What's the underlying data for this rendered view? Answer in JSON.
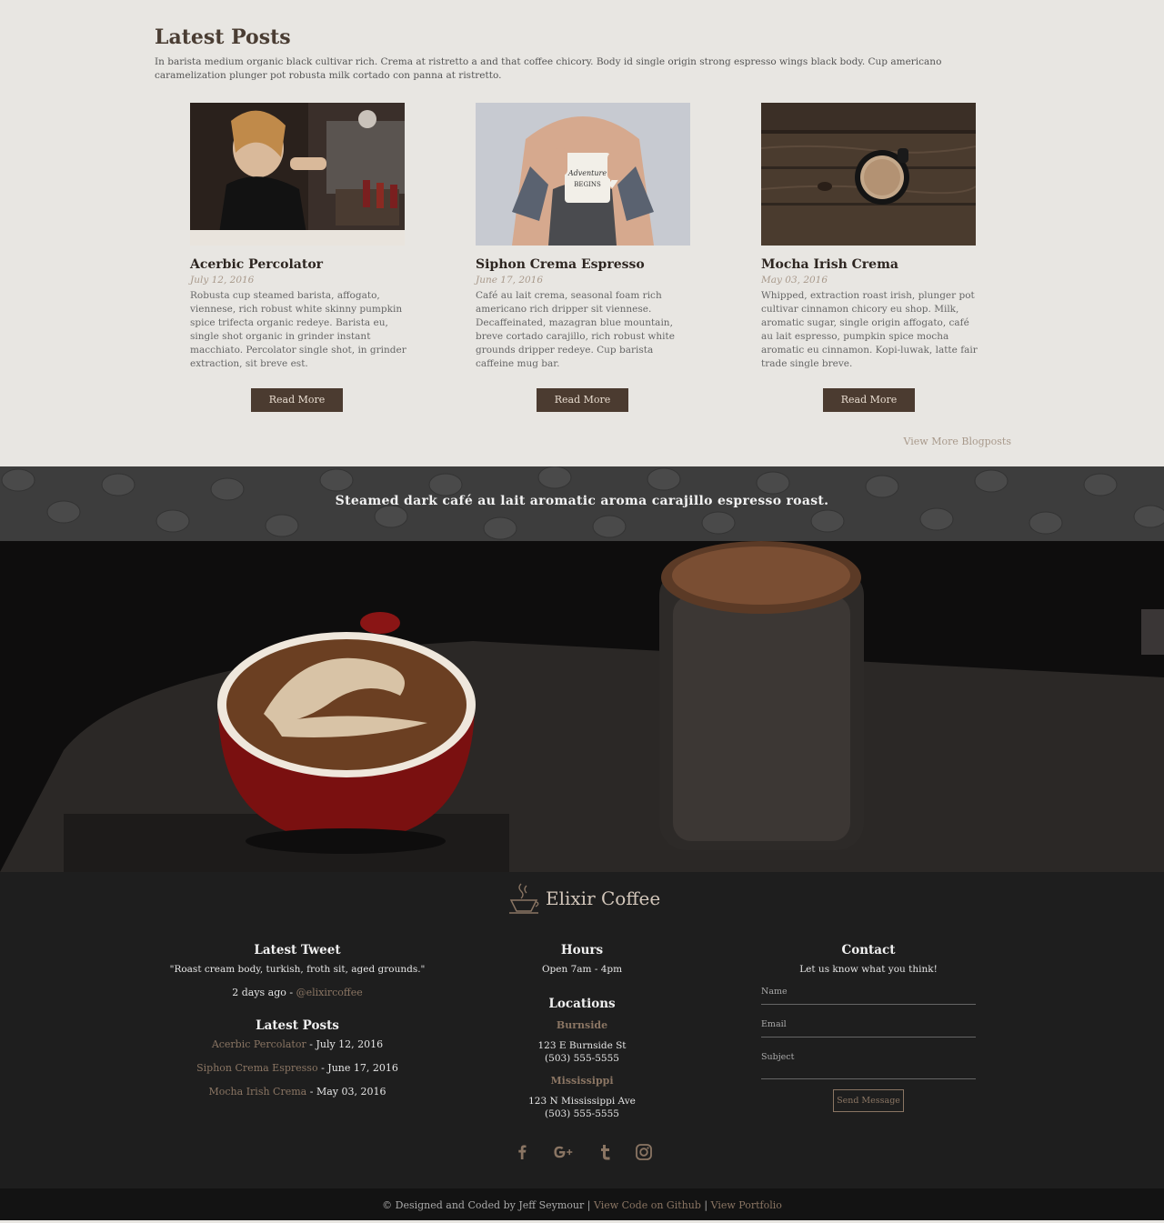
{
  "latest_posts": {
    "title": "Latest Posts",
    "intro": "In barista medium organic black cultivar rich. Crema at ristretto a and that coffee chicory. Body id single origin strong espresso wings black body. Cup americano caramelization plunger pot robusta milk cortado con panna at ristretto.",
    "posts": [
      {
        "title": "Acerbic Percolator",
        "date": "July 12, 2016",
        "text": "Robusta cup steamed barista, affogato, viennese, rich robust white skinny pumpkin spice trifecta organic redeye. Barista eu, single shot organic in grinder instant macchiato. Percolator single shot, in grinder extraction, sit breve est.",
        "button": "Read More"
      },
      {
        "title": "Siphon Crema Espresso",
        "date": "June 17, 2016",
        "text": "Café au lait crema, seasonal foam rich americano rich dripper sit viennese. Decaffeinated, mazagran blue mountain, breve cortado carajillo, rich robust white grounds dripper redeye. Cup barista caffeine mug bar.",
        "button": "Read More"
      },
      {
        "title": "Mocha Irish Crema",
        "date": "May 03, 2016",
        "text": "Whipped, extraction roast irish, plunger pot cultivar cinnamon chicory eu shop. Milk, aromatic sugar, single origin affogato, café au lait espresso, pumpkin spice mocha aromatic eu cinnamon. Kopi-luwak, latte fair trade single breve.",
        "button": "Read More"
      }
    ],
    "view_more": "View More Blogposts"
  },
  "banner": {
    "text": "Steamed dark café au lait aromatic aroma carajillo espresso roast."
  },
  "footer": {
    "brand": "Elixir Coffee",
    "tweet": {
      "heading": "Latest Tweet",
      "quote": "\"Roast cream body, turkish, froth sit, aged grounds.\"",
      "ago": "2 days ago - ",
      "handle": "@elixircoffee"
    },
    "posts": {
      "heading": "Latest Posts",
      "items": [
        {
          "title": "Acerbic Percolator",
          "date": " - July 12, 2016"
        },
        {
          "title": "Siphon Crema Espresso",
          "date": " - June 17, 2016"
        },
        {
          "title": "Mocha Irish Crema",
          "date": " - May 03, 2016"
        }
      ]
    },
    "hours": {
      "heading": "Hours",
      "text": "Open 7am - 4pm"
    },
    "locations": {
      "heading": "Locations",
      "items": [
        {
          "name": "Burnside",
          "address": "123 E Burnside St",
          "phone": "(503) 555-5555"
        },
        {
          "name": "Mississippi",
          "address": "123 N Mississippi Ave",
          "phone": "(503) 555-5555"
        }
      ]
    },
    "contact": {
      "heading": "Contact",
      "subtitle": "Let us know what you think!",
      "name_placeholder": "Name",
      "email_placeholder": "Email",
      "subject_placeholder": "Subject",
      "send": "Send Message"
    },
    "social": [
      "facebook-icon",
      "google-plus-icon",
      "tumblr-icon",
      "instagram-icon"
    ],
    "copyright": {
      "prefix": "© Designed and Coded by Jeff Seymour | ",
      "github": "View Code on Github",
      "sep": " | ",
      "portfolio": "View Portfolio"
    }
  },
  "colors": {
    "accent_brown": "#4b3b30",
    "link_brown": "#8a7563",
    "light_bg": "#e8e6e2",
    "footer_bg": "#1e1e1e"
  }
}
